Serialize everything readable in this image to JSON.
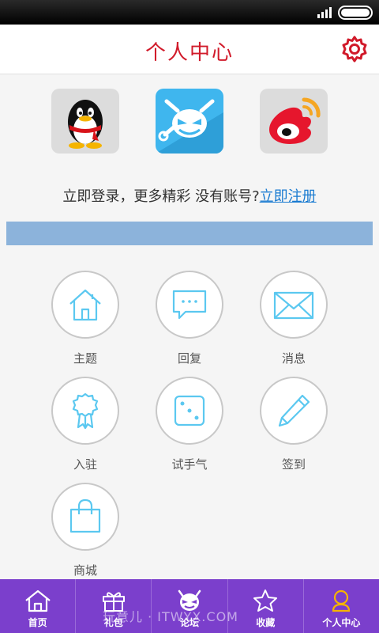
{
  "header": {
    "title": "个人中心"
  },
  "login": {
    "providers": [
      "qq-icon",
      "devil-logo-icon",
      "weibo-icon"
    ],
    "prompt": "立即登录，更多精彩",
    "no_account": "没有账号?",
    "register_link": "立即注册"
  },
  "functions": [
    {
      "label": "主题",
      "icon": "house-icon"
    },
    {
      "label": "回复",
      "icon": "chat-bubble-icon"
    },
    {
      "label": "消息",
      "icon": "envelope-icon"
    },
    {
      "label": "入驻",
      "icon": "ribbon-badge-icon"
    },
    {
      "label": "试手气",
      "icon": "dice-icon"
    },
    {
      "label": "签到",
      "icon": "pencil-icon"
    },
    {
      "label": "商城",
      "icon": "shopping-bag-icon"
    }
  ],
  "tabs": [
    {
      "label": "首页",
      "icon": "house-icon"
    },
    {
      "label": "礼包",
      "icon": "gift-icon"
    },
    {
      "label": "论坛",
      "icon": "devil-face-icon"
    },
    {
      "label": "收藏",
      "icon": "star-icon"
    },
    {
      "label": "个人中心",
      "icon": "person-icon"
    }
  ],
  "watermark": "玩意儿 · ITWYX.COM",
  "colors": {
    "accent": "#d11a2a",
    "tabbar": "#7b3fcc",
    "icon": "#5bc8f0",
    "link": "#1a7bd1"
  }
}
